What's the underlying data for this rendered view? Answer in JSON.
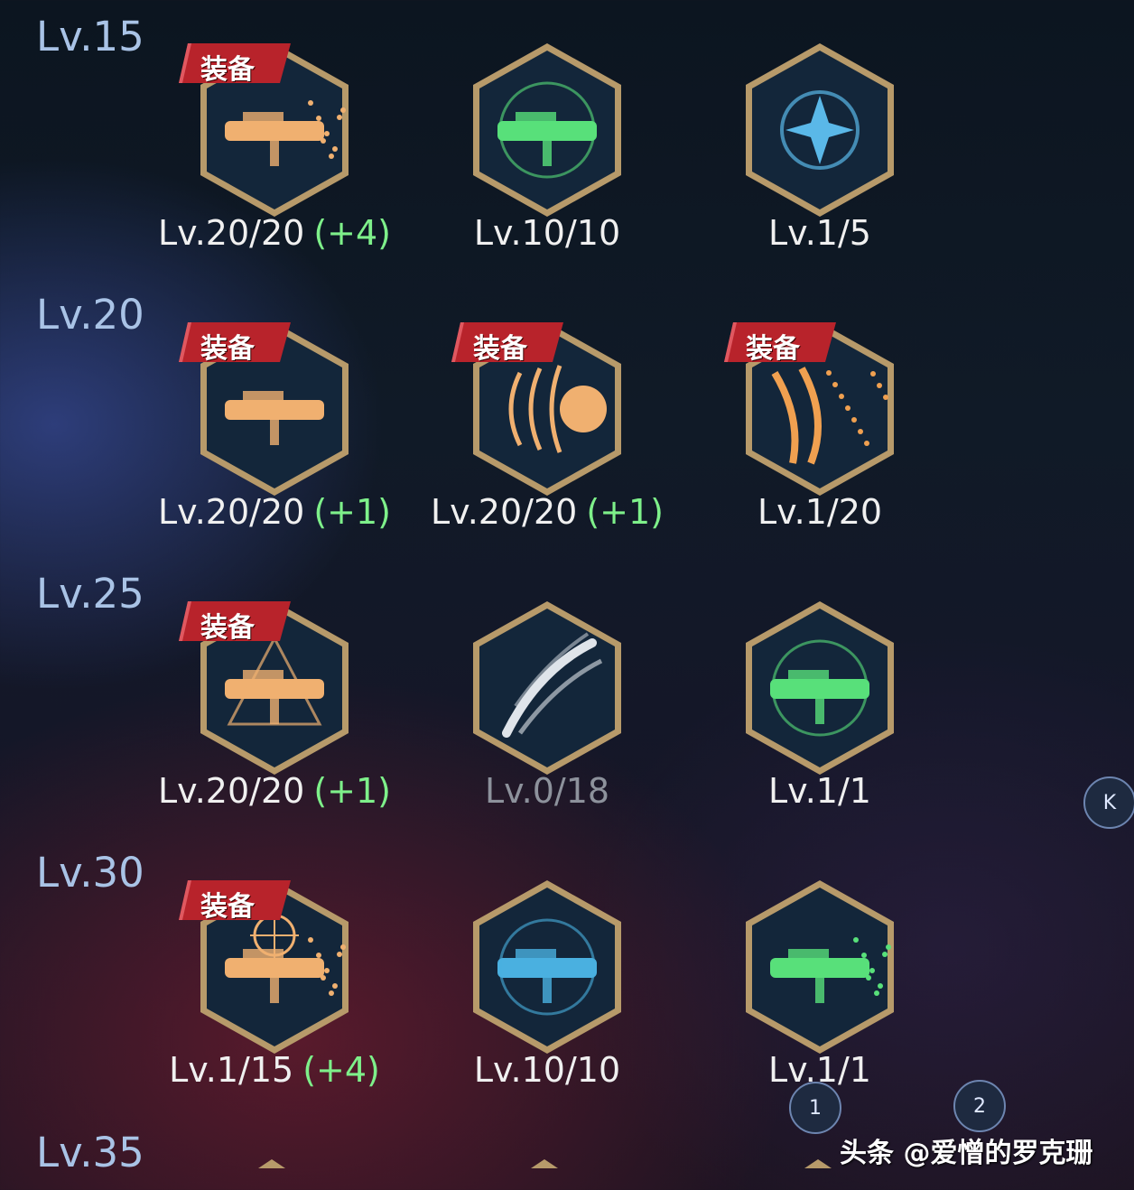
{
  "equip_label": "装备",
  "colors": {
    "tier_label": "#a9c3e6",
    "bonus": "#7ef08a",
    "frame": "#b79a6a",
    "hex_fill": "#13263a"
  },
  "tiers": [
    {
      "label": "Lv.15",
      "skills": [
        {
          "icon": "flamethrower-icon",
          "equipped": true,
          "level": "Lv.20/20",
          "bonus": "(+4)",
          "color": "#f0b070"
        },
        {
          "icon": "green-turret-icon",
          "equipped": false,
          "level": "Lv.10/10",
          "bonus": "",
          "color": "#58e07a"
        },
        {
          "icon": "blue-shark-icon",
          "equipped": false,
          "level": "Lv.1/5",
          "bonus": "",
          "color": "#5ab8e8"
        }
      ]
    },
    {
      "label": "Lv.20",
      "skills": [
        {
          "icon": "heavy-gun-icon",
          "equipped": true,
          "level": "Lv.20/20",
          "bonus": "(+1)",
          "color": "#f0b070"
        },
        {
          "icon": "shockwave-ball-icon",
          "equipped": true,
          "level": "Lv.20/20",
          "bonus": "(+1)",
          "color": "#f0b070"
        },
        {
          "icon": "claw-sparks-icon",
          "equipped": true,
          "level": "Lv.1/20",
          "bonus": "",
          "color": "#f0a050"
        }
      ]
    },
    {
      "label": "Lv.25",
      "skills": [
        {
          "icon": "star-gun-icon",
          "equipped": true,
          "level": "Lv.20/20",
          "bonus": "(+1)",
          "color": "#f0b070"
        },
        {
          "icon": "slash-icon",
          "equipped": false,
          "level": "Lv.0/18",
          "bonus": "",
          "color": "#dfe4ea",
          "dim": true
        },
        {
          "icon": "green-sparkle-turret-icon",
          "equipped": false,
          "level": "Lv.1/1",
          "bonus": "",
          "color": "#58e07a"
        }
      ]
    },
    {
      "label": "Lv.30",
      "skills": [
        {
          "icon": "crosshair-flame-icon",
          "equipped": true,
          "level": "Lv.1/15",
          "bonus": "(+4)",
          "color": "#f0b070"
        },
        {
          "icon": "blue-turret-icon",
          "equipped": false,
          "level": "Lv.10/10",
          "bonus": "",
          "color": "#4ab0e0"
        },
        {
          "icon": "green-burst-gun-icon",
          "equipped": false,
          "level": "Lv.1/1",
          "bonus": "",
          "color": "#58e07a"
        }
      ]
    },
    {
      "label": "Lv.35",
      "skills": []
    }
  ],
  "buttons": {
    "collapse": "K",
    "page1": "1",
    "page2": "2"
  },
  "watermark": "头条 @爱憎的罗克珊"
}
